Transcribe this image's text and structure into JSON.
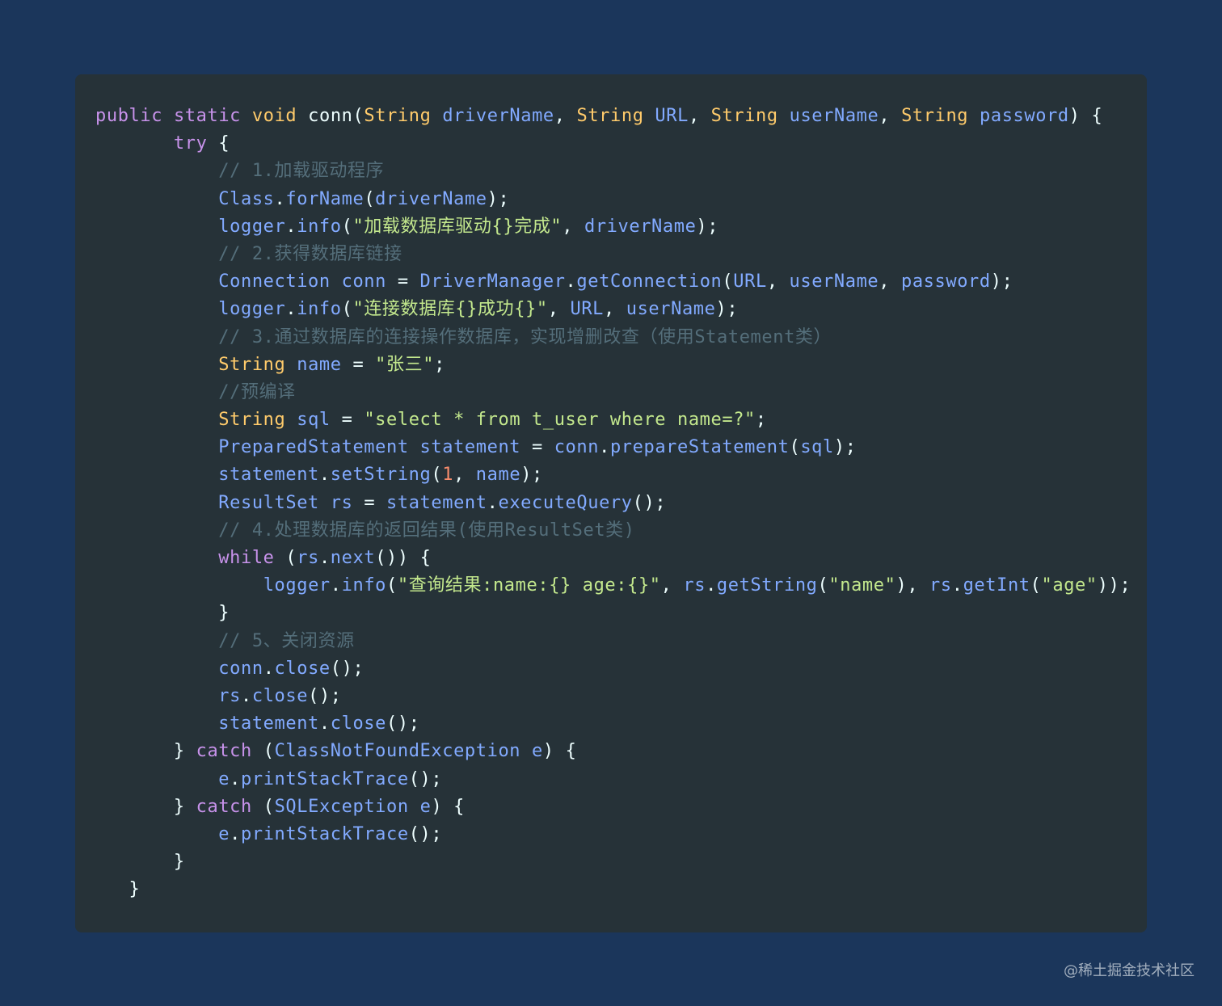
{
  "code": {
    "language": "java",
    "lines": [
      [
        {
          "t": "public",
          "c": "kw"
        },
        {
          "t": " ",
          "c": "pl"
        },
        {
          "t": "static",
          "c": "kw"
        },
        {
          "t": " ",
          "c": "pl"
        },
        {
          "t": "void",
          "c": "ty"
        },
        {
          "t": " ",
          "c": "pl"
        },
        {
          "t": "conn",
          "c": "pl"
        },
        {
          "t": "(",
          "c": "pl"
        },
        {
          "t": "String",
          "c": "ty"
        },
        {
          "t": " ",
          "c": "pl"
        },
        {
          "t": "driverName",
          "c": "fn"
        },
        {
          "t": ", ",
          "c": "pl"
        },
        {
          "t": "String",
          "c": "ty"
        },
        {
          "t": " ",
          "c": "pl"
        },
        {
          "t": "URL",
          "c": "fn"
        },
        {
          "t": ", ",
          "c": "pl"
        },
        {
          "t": "String",
          "c": "ty"
        },
        {
          "t": " ",
          "c": "pl"
        },
        {
          "t": "userName",
          "c": "fn"
        },
        {
          "t": ", ",
          "c": "pl"
        },
        {
          "t": "String",
          "c": "ty"
        },
        {
          "t": " ",
          "c": "pl"
        },
        {
          "t": "password",
          "c": "fn"
        },
        {
          "t": ") {",
          "c": "pl"
        }
      ],
      [
        {
          "t": "       ",
          "c": "pl"
        },
        {
          "t": "try",
          "c": "kw"
        },
        {
          "t": " {",
          "c": "pl"
        }
      ],
      [
        {
          "t": "           ",
          "c": "pl"
        },
        {
          "t": "// 1.加载驱动程序",
          "c": "cm"
        }
      ],
      [
        {
          "t": "           ",
          "c": "pl"
        },
        {
          "t": "Class",
          "c": "fn"
        },
        {
          "t": ".",
          "c": "pl"
        },
        {
          "t": "forName",
          "c": "fn"
        },
        {
          "t": "(",
          "c": "pl"
        },
        {
          "t": "driverName",
          "c": "fn"
        },
        {
          "t": ");",
          "c": "pl"
        }
      ],
      [
        {
          "t": "           ",
          "c": "pl"
        },
        {
          "t": "logger",
          "c": "fn"
        },
        {
          "t": ".",
          "c": "pl"
        },
        {
          "t": "info",
          "c": "fn"
        },
        {
          "t": "(",
          "c": "pl"
        },
        {
          "t": "\"加载数据库驱动{}完成\"",
          "c": "str"
        },
        {
          "t": ", ",
          "c": "pl"
        },
        {
          "t": "driverName",
          "c": "fn"
        },
        {
          "t": ");",
          "c": "pl"
        }
      ],
      [
        {
          "t": "           ",
          "c": "pl"
        },
        {
          "t": "// 2.获得数据库链接",
          "c": "cm"
        }
      ],
      [
        {
          "t": "           ",
          "c": "pl"
        },
        {
          "t": "Connection",
          "c": "fn"
        },
        {
          "t": " ",
          "c": "pl"
        },
        {
          "t": "conn",
          "c": "fn"
        },
        {
          "t": " = ",
          "c": "pl"
        },
        {
          "t": "DriverManager",
          "c": "fn"
        },
        {
          "t": ".",
          "c": "pl"
        },
        {
          "t": "getConnection",
          "c": "fn"
        },
        {
          "t": "(",
          "c": "pl"
        },
        {
          "t": "URL",
          "c": "fn"
        },
        {
          "t": ", ",
          "c": "pl"
        },
        {
          "t": "userName",
          "c": "fn"
        },
        {
          "t": ", ",
          "c": "pl"
        },
        {
          "t": "password",
          "c": "fn"
        },
        {
          "t": ");",
          "c": "pl"
        }
      ],
      [
        {
          "t": "           ",
          "c": "pl"
        },
        {
          "t": "logger",
          "c": "fn"
        },
        {
          "t": ".",
          "c": "pl"
        },
        {
          "t": "info",
          "c": "fn"
        },
        {
          "t": "(",
          "c": "pl"
        },
        {
          "t": "\"连接数据库{}成功{}\"",
          "c": "str"
        },
        {
          "t": ", ",
          "c": "pl"
        },
        {
          "t": "URL",
          "c": "fn"
        },
        {
          "t": ", ",
          "c": "pl"
        },
        {
          "t": "userName",
          "c": "fn"
        },
        {
          "t": ");",
          "c": "pl"
        }
      ],
      [
        {
          "t": "           ",
          "c": "pl"
        },
        {
          "t": "// 3.通过数据库的连接操作数据库，实现增删改查（使用Statement类）",
          "c": "cm"
        }
      ],
      [
        {
          "t": "           ",
          "c": "pl"
        },
        {
          "t": "String",
          "c": "ty"
        },
        {
          "t": " ",
          "c": "pl"
        },
        {
          "t": "name",
          "c": "fn"
        },
        {
          "t": " = ",
          "c": "pl"
        },
        {
          "t": "\"张三\"",
          "c": "str"
        },
        {
          "t": ";",
          "c": "pl"
        }
      ],
      [
        {
          "t": "           ",
          "c": "pl"
        },
        {
          "t": "//预编译",
          "c": "cm"
        }
      ],
      [
        {
          "t": "           ",
          "c": "pl"
        },
        {
          "t": "String",
          "c": "ty"
        },
        {
          "t": " ",
          "c": "pl"
        },
        {
          "t": "sql",
          "c": "fn"
        },
        {
          "t": " = ",
          "c": "pl"
        },
        {
          "t": "\"select * from t_user where name=?\"",
          "c": "str"
        },
        {
          "t": ";",
          "c": "pl"
        }
      ],
      [
        {
          "t": "           ",
          "c": "pl"
        },
        {
          "t": "PreparedStatement",
          "c": "fn"
        },
        {
          "t": " ",
          "c": "pl"
        },
        {
          "t": "statement",
          "c": "fn"
        },
        {
          "t": " = ",
          "c": "pl"
        },
        {
          "t": "conn",
          "c": "fn"
        },
        {
          "t": ".",
          "c": "pl"
        },
        {
          "t": "prepareStatement",
          "c": "fn"
        },
        {
          "t": "(",
          "c": "pl"
        },
        {
          "t": "sql",
          "c": "fn"
        },
        {
          "t": ");",
          "c": "pl"
        }
      ],
      [
        {
          "t": "           ",
          "c": "pl"
        },
        {
          "t": "statement",
          "c": "fn"
        },
        {
          "t": ".",
          "c": "pl"
        },
        {
          "t": "setString",
          "c": "fn"
        },
        {
          "t": "(",
          "c": "pl"
        },
        {
          "t": "1",
          "c": "num"
        },
        {
          "t": ", ",
          "c": "pl"
        },
        {
          "t": "name",
          "c": "fn"
        },
        {
          "t": ");",
          "c": "pl"
        }
      ],
      [
        {
          "t": "           ",
          "c": "pl"
        },
        {
          "t": "ResultSet",
          "c": "fn"
        },
        {
          "t": " ",
          "c": "pl"
        },
        {
          "t": "rs",
          "c": "fn"
        },
        {
          "t": " = ",
          "c": "pl"
        },
        {
          "t": "statement",
          "c": "fn"
        },
        {
          "t": ".",
          "c": "pl"
        },
        {
          "t": "executeQuery",
          "c": "fn"
        },
        {
          "t": "();",
          "c": "pl"
        }
      ],
      [
        {
          "t": "           ",
          "c": "pl"
        },
        {
          "t": "// 4.处理数据库的返回结果(使用ResultSet类)",
          "c": "cm"
        }
      ],
      [
        {
          "t": "           ",
          "c": "pl"
        },
        {
          "t": "while",
          "c": "kw"
        },
        {
          "t": " (",
          "c": "pl"
        },
        {
          "t": "rs",
          "c": "fn"
        },
        {
          "t": ".",
          "c": "pl"
        },
        {
          "t": "next",
          "c": "fn"
        },
        {
          "t": "()) {",
          "c": "pl"
        }
      ],
      [
        {
          "t": "               ",
          "c": "pl"
        },
        {
          "t": "logger",
          "c": "fn"
        },
        {
          "t": ".",
          "c": "pl"
        },
        {
          "t": "info",
          "c": "fn"
        },
        {
          "t": "(",
          "c": "pl"
        },
        {
          "t": "\"查询结果:name:{} age:{}\"",
          "c": "str"
        },
        {
          "t": ", ",
          "c": "pl"
        },
        {
          "t": "rs",
          "c": "fn"
        },
        {
          "t": ".",
          "c": "pl"
        },
        {
          "t": "getString",
          "c": "fn"
        },
        {
          "t": "(",
          "c": "pl"
        },
        {
          "t": "\"name\"",
          "c": "str"
        },
        {
          "t": "), ",
          "c": "pl"
        },
        {
          "t": "rs",
          "c": "fn"
        },
        {
          "t": ".",
          "c": "pl"
        },
        {
          "t": "getInt",
          "c": "fn"
        },
        {
          "t": "(",
          "c": "pl"
        },
        {
          "t": "\"age\"",
          "c": "str"
        },
        {
          "t": "));",
          "c": "pl"
        }
      ],
      [
        {
          "t": "           ",
          "c": "pl"
        },
        {
          "t": "}",
          "c": "pl"
        }
      ],
      [
        {
          "t": "           ",
          "c": "pl"
        },
        {
          "t": "// 5、关闭资源",
          "c": "cm"
        }
      ],
      [
        {
          "t": "           ",
          "c": "pl"
        },
        {
          "t": "conn",
          "c": "fn"
        },
        {
          "t": ".",
          "c": "pl"
        },
        {
          "t": "close",
          "c": "fn"
        },
        {
          "t": "();",
          "c": "pl"
        }
      ],
      [
        {
          "t": "           ",
          "c": "pl"
        },
        {
          "t": "rs",
          "c": "fn"
        },
        {
          "t": ".",
          "c": "pl"
        },
        {
          "t": "close",
          "c": "fn"
        },
        {
          "t": "();",
          "c": "pl"
        }
      ],
      [
        {
          "t": "           ",
          "c": "pl"
        },
        {
          "t": "statement",
          "c": "fn"
        },
        {
          "t": ".",
          "c": "pl"
        },
        {
          "t": "close",
          "c": "fn"
        },
        {
          "t": "();",
          "c": "pl"
        }
      ],
      [
        {
          "t": "       ",
          "c": "pl"
        },
        {
          "t": "} ",
          "c": "pl"
        },
        {
          "t": "catch",
          "c": "kw"
        },
        {
          "t": " (",
          "c": "pl"
        },
        {
          "t": "ClassNotFoundException",
          "c": "fn"
        },
        {
          "t": " ",
          "c": "pl"
        },
        {
          "t": "e",
          "c": "fn"
        },
        {
          "t": ") {",
          "c": "pl"
        }
      ],
      [
        {
          "t": "           ",
          "c": "pl"
        },
        {
          "t": "e",
          "c": "fn"
        },
        {
          "t": ".",
          "c": "pl"
        },
        {
          "t": "printStackTrace",
          "c": "fn"
        },
        {
          "t": "();",
          "c": "pl"
        }
      ],
      [
        {
          "t": "       ",
          "c": "pl"
        },
        {
          "t": "} ",
          "c": "pl"
        },
        {
          "t": "catch",
          "c": "kw"
        },
        {
          "t": " (",
          "c": "pl"
        },
        {
          "t": "SQLException",
          "c": "fn"
        },
        {
          "t": " ",
          "c": "pl"
        },
        {
          "t": "e",
          "c": "fn"
        },
        {
          "t": ") {",
          "c": "pl"
        }
      ],
      [
        {
          "t": "           ",
          "c": "pl"
        },
        {
          "t": "e",
          "c": "fn"
        },
        {
          "t": ".",
          "c": "pl"
        },
        {
          "t": "printStackTrace",
          "c": "fn"
        },
        {
          "t": "();",
          "c": "pl"
        }
      ],
      [
        {
          "t": "       ",
          "c": "pl"
        },
        {
          "t": "}",
          "c": "pl"
        }
      ],
      [
        {
          "t": "   ",
          "c": "pl"
        },
        {
          "t": "}",
          "c": "pl"
        }
      ]
    ]
  },
  "watermark": "@稀土掘金技术社区",
  "colors": {
    "page_background": "#1b365b",
    "card_background": "#263238",
    "keyword": "#c792ea",
    "type": "#ffcb6b",
    "identifier": "#82aaff",
    "string": "#c3e88d",
    "comment": "#546e7a",
    "number": "#f78c6c",
    "plain": "#eeffff"
  }
}
